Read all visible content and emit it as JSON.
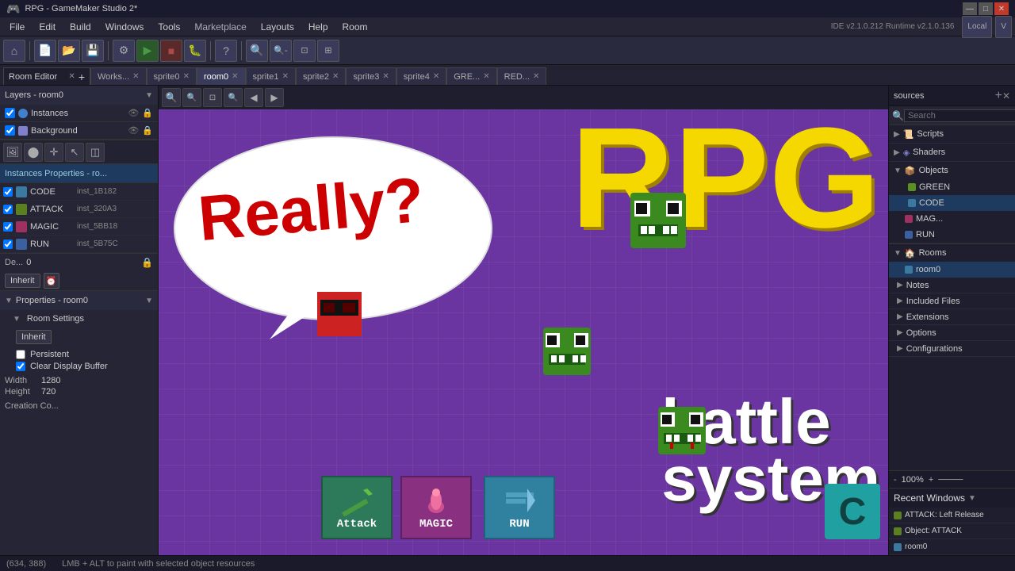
{
  "titlebar": {
    "title": "RPG - GameMaker Studio 2*",
    "minimize": "—",
    "maximize": "□",
    "close": "✕"
  },
  "menubar": {
    "items": [
      "File",
      "Edit",
      "Build",
      "Windows",
      "Tools",
      "Marketplace",
      "Layouts",
      "Help",
      "Room"
    ],
    "version": "IDE v2.1.0.212 Runtime v2.1.0.136"
  },
  "tabs": [
    {
      "label": "Works...",
      "active": false,
      "closable": true
    },
    {
      "label": "sprite0",
      "active": false,
      "closable": true
    },
    {
      "label": "room0",
      "active": true,
      "closable": true
    },
    {
      "label": "sprite1",
      "active": false,
      "closable": true
    },
    {
      "label": "sprite2",
      "active": false,
      "closable": true
    },
    {
      "label": "sprite3",
      "active": false,
      "closable": true
    },
    {
      "label": "sprite4",
      "active": false,
      "closable": true
    },
    {
      "label": "GRE...",
      "active": false,
      "closable": true
    },
    {
      "label": "RED...",
      "active": false,
      "closable": true
    }
  ],
  "left_panel": {
    "room_editor_label": "Room Editor",
    "layers_title": "Layers - room0",
    "layers": [
      {
        "name": "Instances",
        "color": "#4080cc",
        "type": "instance"
      },
      {
        "name": "Background",
        "color": "#8080cc",
        "type": "background"
      }
    ],
    "instances_properties_title": "Instances Properties - ro...",
    "instances": [
      {
        "name": "CODE",
        "id": "inst_1B182",
        "color": "#3a7aa0",
        "checked": true
      },
      {
        "name": "ATTACK",
        "id": "inst_320A3",
        "color": "#5a8020",
        "checked": true
      },
      {
        "name": "MAGIC",
        "id": "inst_5BB18",
        "color": "#a03060",
        "checked": true
      },
      {
        "name": "RUN",
        "id": "inst_5B75C",
        "color": "#3a60a0",
        "checked": true
      }
    ],
    "depth_label": "De...",
    "depth_value": "0",
    "inherit_btn": "Inherit",
    "properties_title": "Properties - room0",
    "room_settings_label": "Room Settings",
    "inherit_btn2": "Inherit",
    "persistent_label": "Persistent",
    "persistent_checked": false,
    "clear_display_label": "Clear Display Buffer",
    "clear_display_checked": true,
    "width_label": "Width",
    "width_value": "1280",
    "height_label": "Height",
    "height_value": "720",
    "creation_label": "Creation Co..."
  },
  "canvas": {
    "rpg_text": "RPG",
    "battle_text": "battle\nsystem",
    "really_text": "Really?",
    "attack_label": "Attack",
    "magic_label": "MAGIC",
    "run_label": "RUN",
    "c_label": "C"
  },
  "right_panel": {
    "title": "sources",
    "search_placeholder": "Search",
    "groups": [
      {
        "label": "Scripts",
        "expanded": false
      },
      {
        "label": "Shaders",
        "expanded": false
      },
      {
        "label": "Objects",
        "expanded": false
      }
    ],
    "resource_items": [
      {
        "label": "GREEN",
        "color": "#5a9020",
        "selected": false
      },
      {
        "label": "CODE",
        "color": "#3a7aa0",
        "selected": false
      },
      {
        "label": "MAG...",
        "color": "#a03060",
        "selected": false
      },
      {
        "label": "RUN",
        "color": "#3a60a0",
        "selected": false
      }
    ],
    "rooms_label": "Rooms",
    "room0_label": "room0",
    "notes_label": "Notes",
    "included_files_label": "Included Files",
    "extensions_label": "Extensions",
    "options_label": "Options",
    "configurations_label": "Configurations",
    "zoom_value": "100%",
    "recent_windows_label": "Recent Windows",
    "recent_items": [
      {
        "label": "ATTACK: Left Release",
        "color": "#5a8020"
      },
      {
        "label": "Object: ATTACK",
        "color": "#5a8020"
      },
      {
        "label": "room0",
        "color": "#3a7aa0"
      }
    ]
  },
  "statusbar": {
    "coords": "(634, 388)",
    "hint": "LMB + ALT to paint with selected object resources"
  }
}
